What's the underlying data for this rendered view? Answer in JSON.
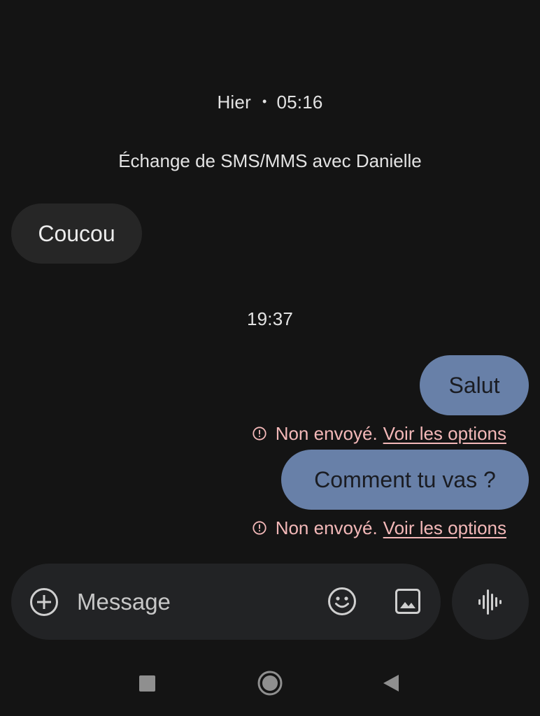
{
  "conversation": {
    "day_label": "Hier",
    "day_separator": "•",
    "day_time": "05:16",
    "sms_notice": "Échange de SMS/MMS avec Danielle",
    "evening_time": "19:37"
  },
  "messages": [
    {
      "direction": "incoming",
      "text": "Coucou"
    },
    {
      "direction": "outgoing",
      "text": "Salut",
      "status": "Non envoyé.",
      "action": "Voir les options"
    },
    {
      "direction": "outgoing",
      "text": "Comment tu vas ?",
      "status": "Non envoyé.",
      "action": "Voir les options"
    }
  ],
  "composer": {
    "placeholder": "Message",
    "icons": [
      "add-circle-icon",
      "emoji-icon",
      "gallery-icon",
      "voice-waveform-icon"
    ]
  },
  "navigation": {
    "icons": [
      "recents-square-icon",
      "home-circle-icon",
      "back-triangle-icon"
    ]
  },
  "colors": {
    "background": "#141414",
    "incoming_bubble": "#262626",
    "outgoing_bubble": "#6880a8",
    "error_text": "#f3b8b8",
    "composer_bg": "#222325"
  }
}
